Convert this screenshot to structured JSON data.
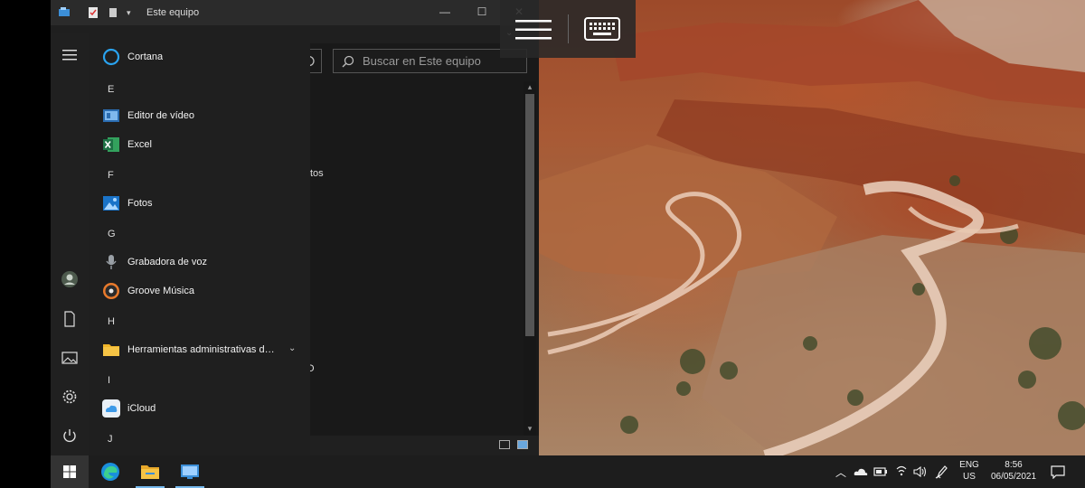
{
  "explorer": {
    "title": "Este equipo",
    "search_placeholder": "Buscar en Este equipo",
    "content_fragments": [
      "tos",
      "O"
    ]
  },
  "start_menu": {
    "items": [
      {
        "type": "app",
        "label": "Cortana",
        "icon": "cortana-icon"
      },
      {
        "type": "letter",
        "label": "E"
      },
      {
        "type": "app",
        "label": "Editor de vídeo",
        "icon": "video-editor-icon"
      },
      {
        "type": "app",
        "label": "Excel",
        "icon": "excel-icon"
      },
      {
        "type": "letter",
        "label": "F"
      },
      {
        "type": "app",
        "label": "Fotos",
        "icon": "photos-icon"
      },
      {
        "type": "letter",
        "label": "G"
      },
      {
        "type": "app",
        "label": "Grabadora de voz",
        "icon": "microphone-icon"
      },
      {
        "type": "app",
        "label": "Groove Música",
        "icon": "groove-music-icon"
      },
      {
        "type": "letter",
        "label": "H"
      },
      {
        "type": "app",
        "label": "Herramientas administrativas de...",
        "icon": "folder-icon"
      },
      {
        "type": "letter",
        "label": "I"
      },
      {
        "type": "app",
        "label": "iCloud",
        "icon": "icloud-icon"
      },
      {
        "type": "letter",
        "label": "J"
      }
    ]
  },
  "taskbar": {
    "language": "ENG",
    "region": "US",
    "time": "8:56",
    "date": "06/05/2021"
  },
  "colors": {
    "accent": "#76b9ed",
    "excel": "#1e7145",
    "start_bg": "#1f1f1f",
    "taskbar_bg": "#1d1d1d"
  }
}
